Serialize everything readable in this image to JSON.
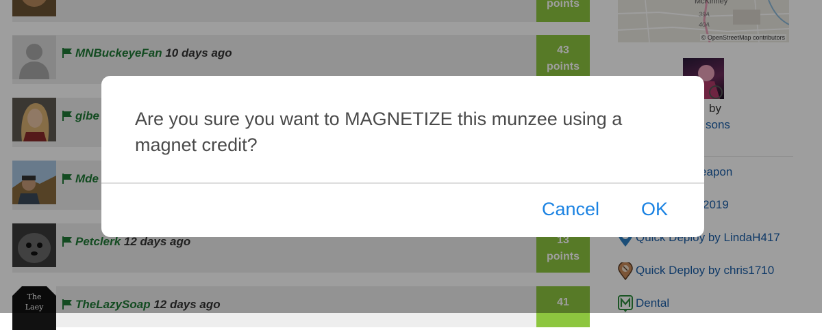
{
  "feed": {
    "rows": [
      {
        "user": "",
        "time": "",
        "points_value": "",
        "points_label": "points"
      },
      {
        "user": "MNBuckeyeFan",
        "time": "10 days ago",
        "points_value": "43",
        "points_label": "points"
      },
      {
        "user": "gibe",
        "time": "",
        "points_value": "",
        "points_label": ""
      },
      {
        "user": "Mde",
        "time": "",
        "points_value": "",
        "points_label": ""
      },
      {
        "user": "Petclerk",
        "time": "12 days ago",
        "points_value": "13",
        "points_label": "points"
      },
      {
        "user": "TheLazySoap",
        "time": "12 days ago",
        "points_value": "41",
        "points_label": ""
      }
    ],
    "lazy_avatar_text": [
      "The",
      "Laey"
    ]
  },
  "sidebar": {
    "map": {
      "city": "McKinney",
      "credit": "© OpenStreetMap contributors",
      "road_labels": [
        "39A",
        "40A"
      ]
    },
    "creator_by": "by",
    "creator_name": "sons",
    "items": [
      {
        "label": "eapon"
      },
      {
        "label": "2019"
      },
      {
        "label": "Quick Deploy by LindaH417",
        "icon": "blue-map-pin-icon"
      },
      {
        "label": "Quick Deploy by chris1710",
        "icon": "brown-map-pin-icon"
      },
      {
        "label": "Dental",
        "icon": "green-m-badge-icon"
      }
    ]
  },
  "dialog": {
    "message": "Are you sure you want to MAGNETIZE this munzee using a magnet credit?",
    "cancel_label": "Cancel",
    "ok_label": "OK"
  },
  "colors": {
    "points_bg": "#8dc63f",
    "username": "#1f7a36",
    "link": "#1a5ea8",
    "dialog_button": "#1a82e2"
  }
}
